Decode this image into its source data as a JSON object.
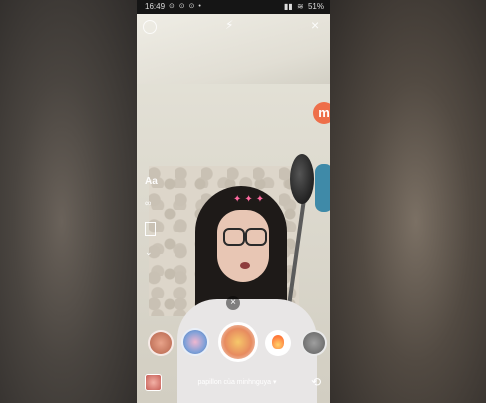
{
  "status_bar": {
    "time": "16:49",
    "left_icons": "⊙ ⊙ ⊙ •",
    "signal": "▮▮",
    "wifi": "≋",
    "battery": "51%"
  },
  "badge": {
    "label": "m"
  },
  "tools": {
    "text_tool": "Aa",
    "boomerang": "∞",
    "more": "⌄"
  },
  "effects": [
    {
      "name": "effect-1"
    },
    {
      "name": "effect-2"
    },
    {
      "name": "effect-selected"
    },
    {
      "name": "effect-4"
    },
    {
      "name": "effect-5"
    }
  ],
  "effect_remove": "×",
  "close": "×",
  "flash": "⚡",
  "caption": "papillon của minhnguya ▾",
  "colors": {
    "badge": "#ee6f4a",
    "statusbar": "#151515"
  }
}
